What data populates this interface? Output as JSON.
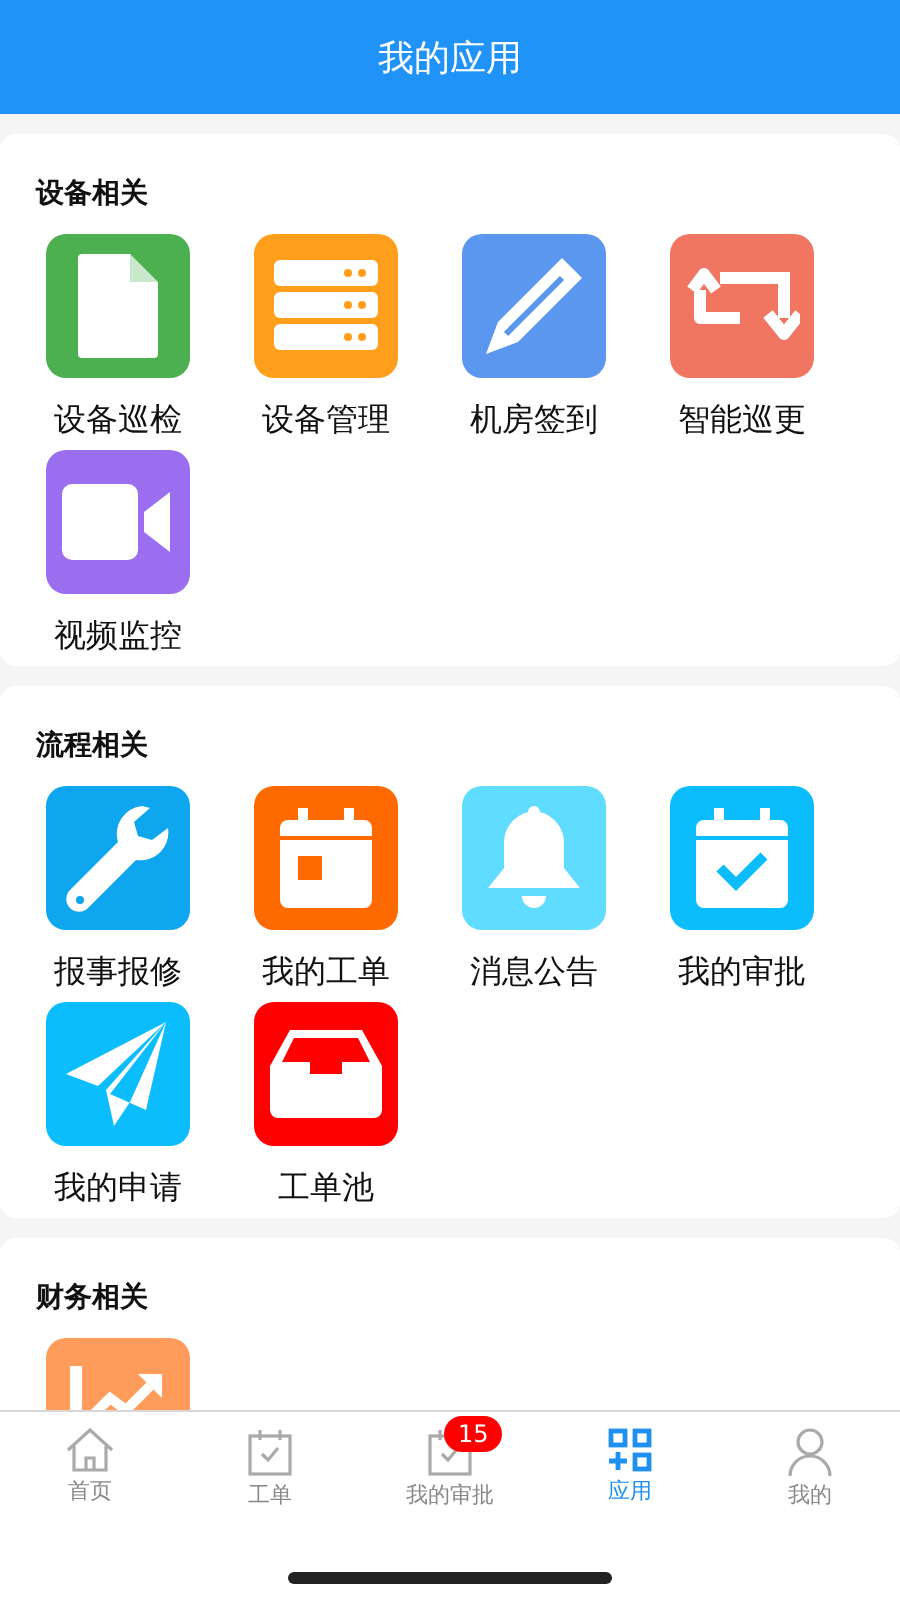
{
  "header": {
    "title": "我的应用"
  },
  "sections": [
    {
      "title": "设备相关",
      "apps": [
        {
          "label": "设备巡检",
          "kind": "document",
          "color": "#4caf50"
        },
        {
          "label": "设备管理",
          "kind": "server",
          "color": "#ff9f1c"
        },
        {
          "label": "机房签到",
          "kind": "pencil",
          "color": "#5b97ef"
        },
        {
          "label": "智能巡更",
          "kind": "repeat",
          "color": "#f07662"
        },
        {
          "label": "视频监控",
          "kind": "video",
          "color": "#9b6ef0"
        }
      ]
    },
    {
      "title": "流程相关",
      "apps": [
        {
          "label": "报事报修",
          "kind": "wrench",
          "color": "#0ea6ef"
        },
        {
          "label": "我的工单",
          "kind": "calendar",
          "color": "#ff6a00"
        },
        {
          "label": "消息公告",
          "kind": "bell",
          "color": "#5fdcff"
        },
        {
          "label": "我的审批",
          "kind": "calendar-check",
          "color": "#0bbdfd"
        },
        {
          "label": "我的申请",
          "kind": "plane",
          "color": "#0bbdfd"
        },
        {
          "label": "工单池",
          "kind": "inbox",
          "color": "#ff0000"
        }
      ]
    },
    {
      "title": "财务相关",
      "apps": [
        {
          "kind": "chart",
          "color": "#ff9c5b"
        }
      ]
    }
  ],
  "tabs": [
    {
      "label": "首页",
      "kind": "home",
      "selected": false
    },
    {
      "label": "工单",
      "kind": "task",
      "selected": false
    },
    {
      "label": "我的审批",
      "kind": "task",
      "selected": false,
      "badge": "15"
    },
    {
      "label": "应用",
      "kind": "apps",
      "selected": true
    },
    {
      "label": "我的",
      "kind": "user",
      "selected": false
    }
  ]
}
